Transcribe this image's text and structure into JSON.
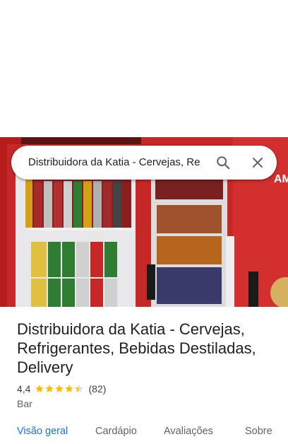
{
  "search": {
    "query": "Distribuidora da Katia - Cervejas, Re",
    "search_icon": "search-icon",
    "close_icon": "close-icon"
  },
  "hero": {
    "photo_icon": "storefront-photo",
    "sign_text": "AM"
  },
  "place": {
    "title": "Distribuidora da Katia - Cervejas, Refrigerantes, Bebidas Destiladas, Delivery",
    "rating": "4,4",
    "stars": 4.4,
    "reviews": "(82)",
    "category": "Bar"
  },
  "tabs": [
    {
      "label": "Visão geral",
      "active": true
    },
    {
      "label": "Cardápio",
      "active": false
    },
    {
      "label": "Avaliações",
      "active": false
    },
    {
      "label": "Sobre",
      "active": false
    }
  ],
  "colors": {
    "accent": "#1a73e8",
    "star": "#fbbc04",
    "fridge_red": "#d32f2f"
  }
}
